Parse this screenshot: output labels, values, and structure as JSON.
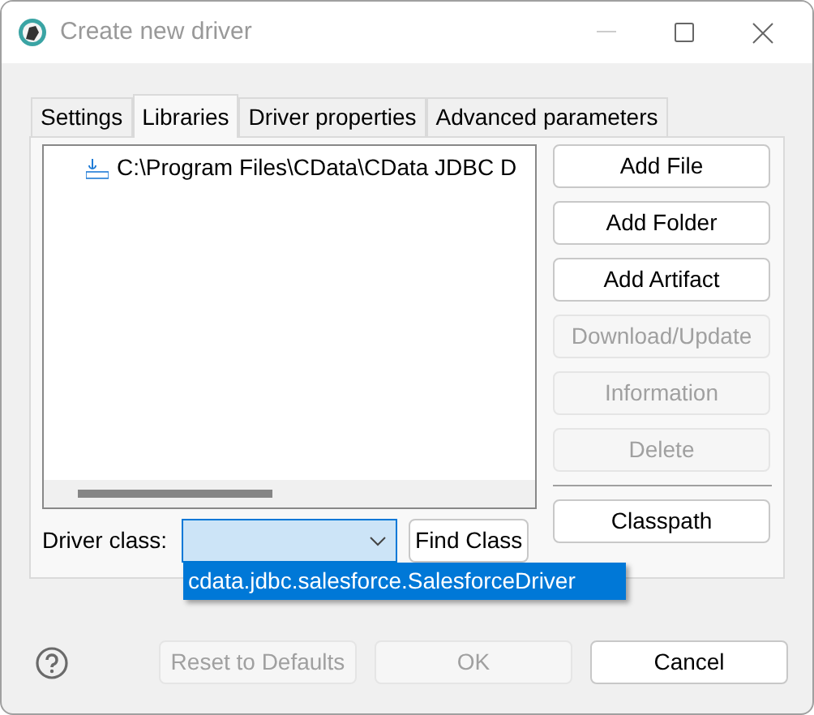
{
  "window": {
    "title": "Create new driver"
  },
  "tabs": [
    {
      "label": "Settings",
      "selected": false
    },
    {
      "label": "Libraries",
      "selected": true
    },
    {
      "label": "Driver properties",
      "selected": false
    },
    {
      "label": "Advanced parameters",
      "selected": false
    }
  ],
  "libraries": [
    {
      "path": "C:\\Program Files\\CData\\CData JDBC D"
    }
  ],
  "side_buttons": [
    {
      "label": "Add File",
      "disabled": false
    },
    {
      "label": "Add Folder",
      "disabled": false
    },
    {
      "label": "Add Artifact",
      "disabled": false
    },
    {
      "label": "Download/Update",
      "disabled": true
    },
    {
      "label": "Information",
      "disabled": true
    },
    {
      "label": "Delete",
      "disabled": true
    }
  ],
  "classpath_button": "Classpath",
  "driver_class": {
    "label": "Driver class:",
    "find_button": "Find Class",
    "options": [
      "cdata.jdbc.salesforce.SalesforceDriver"
    ]
  },
  "footer_buttons": [
    {
      "label": "Reset to Defaults",
      "disabled": true
    },
    {
      "label": "OK",
      "disabled": true
    },
    {
      "label": "Cancel",
      "disabled": false
    }
  ]
}
